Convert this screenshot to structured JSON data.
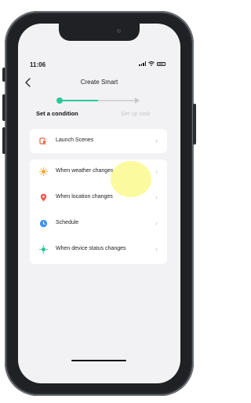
{
  "status": {
    "time": "11:06"
  },
  "header": {
    "title": "Create Smart"
  },
  "steps": {
    "active": "Set a condition",
    "next": "Set up task"
  },
  "scenes_card": {
    "items": [
      {
        "label": "Launch Scenes",
        "icon": "launch-scenes-icon"
      }
    ]
  },
  "conditions_card": {
    "items": [
      {
        "label": "When weather changes",
        "icon": "sun-icon"
      },
      {
        "label": "When location changes",
        "icon": "location-pin-icon"
      },
      {
        "label": "Schedule",
        "icon": "clock-icon"
      },
      {
        "label": "When device status changes",
        "icon": "device-status-icon"
      }
    ]
  },
  "colors": {
    "accent_green": "#2ec79b",
    "touch_highlight": "#faf878",
    "launch_icon": "#e8664a",
    "weather_icon": "#f5a623",
    "location_icon": "#ef5350",
    "schedule_icon": "#3d8ff0",
    "device_icon": "#2ec79b"
  }
}
